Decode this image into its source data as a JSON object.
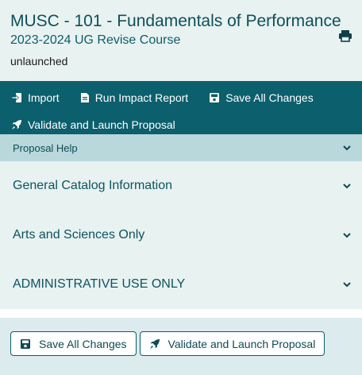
{
  "header": {
    "title": "MUSC - 101 - Fundamentals of Performance",
    "subtitle": "2023-2024 UG Revise Course",
    "status": "unlaunched",
    "print_icon": "print-icon"
  },
  "toolbar": {
    "import_label": "Import",
    "impact_label": "Run Impact Report",
    "save_label": "Save All Changes",
    "validate_label": "Validate and Launch Proposal"
  },
  "help": {
    "label": "Proposal Help"
  },
  "sections": [
    {
      "label": "General Catalog Information"
    },
    {
      "label": "Arts and Sciences Only"
    },
    {
      "label": "ADMINISTRATIVE USE ONLY"
    }
  ],
  "footer": {
    "save_label": "Save All Changes",
    "validate_label": "Validate and Launch Proposal"
  },
  "colors": {
    "toolbar_bg": "#0c5f6c",
    "header_bg": "#e8f2f1",
    "help_bg": "#b9d8dc",
    "accent": "#0d4a55"
  }
}
